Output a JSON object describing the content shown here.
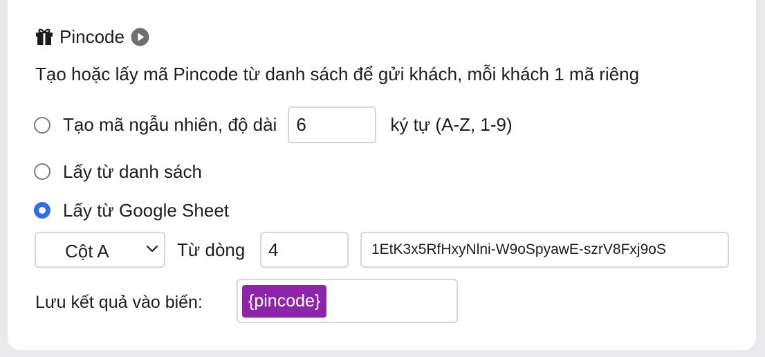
{
  "section": {
    "title": "Pincode",
    "icons": {
      "title_icon": "gift-icon",
      "help_icon": "play-icon"
    },
    "description": "Tạo hoặc lấy mã Pincode từ danh sách để gửi khách, mỗi khách 1 mã riêng"
  },
  "options": {
    "random": {
      "label": "Tạo mã ngẫu nhiên, độ dài",
      "length_value": "6",
      "suffix": "ký tự (A-Z, 1-9)",
      "selected": false
    },
    "from_list": {
      "label": "Lấy từ danh sách",
      "selected": false
    },
    "from_google_sheet": {
      "label": "Lấy từ Google Sheet",
      "selected": true,
      "column_select": "Cột A",
      "from_row_label": "Từ dòng",
      "from_row_value": "4",
      "sheet_id_value": "1EtK3x5RfHxyNlni-W9oSpyawE-szrV8Fxj9oS"
    }
  },
  "save": {
    "label": "Lưu kết quả vào biến:",
    "variable": "{pincode}"
  },
  "colors": {
    "accent": "#2f6fed",
    "variable_chip": "#8e24aa",
    "background": "#e9e9ec",
    "card": "#ffffff"
  }
}
